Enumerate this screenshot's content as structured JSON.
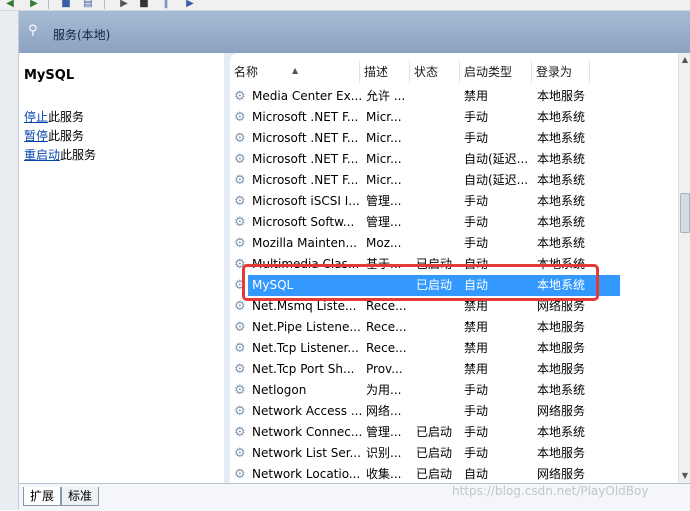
{
  "header": {
    "title": "服务(本地)"
  },
  "leftpane": {
    "service_name": "MySQL",
    "actions": [
      {
        "link": "停止",
        "text": "此服务"
      },
      {
        "link": "暂停",
        "text": "此服务"
      },
      {
        "link": "重启动",
        "text": "此服务"
      }
    ]
  },
  "columns": {
    "name": "名称",
    "desc": "描述",
    "status": "状态",
    "type": "启动类型",
    "logon": "登录为"
  },
  "rows": [
    {
      "name": "Media Center Ex...",
      "desc": "允许 ...",
      "status": "",
      "type": "禁用",
      "logon": "本地服务"
    },
    {
      "name": "Microsoft .NET F...",
      "desc": "Micr...",
      "status": "",
      "type": "手动",
      "logon": "本地系统"
    },
    {
      "name": "Microsoft .NET F...",
      "desc": "Micr...",
      "status": "",
      "type": "手动",
      "logon": "本地系统"
    },
    {
      "name": "Microsoft .NET F...",
      "desc": "Micr...",
      "status": "",
      "type": "自动(延迟...",
      "logon": "本地系统"
    },
    {
      "name": "Microsoft .NET F...",
      "desc": "Micr...",
      "status": "",
      "type": "自动(延迟...",
      "logon": "本地系统"
    },
    {
      "name": "Microsoft iSCSI I...",
      "desc": "管理...",
      "status": "",
      "type": "手动",
      "logon": "本地系统"
    },
    {
      "name": "Microsoft Softw...",
      "desc": "管理...",
      "status": "",
      "type": "手动",
      "logon": "本地系统"
    },
    {
      "name": "Mozilla Mainten...",
      "desc": "Moz...",
      "status": "",
      "type": "手动",
      "logon": "本地系统"
    },
    {
      "name": "Multimedia Clas...",
      "desc": "基于...",
      "status": "已启动",
      "type": "自动",
      "logon": "本地系统"
    },
    {
      "name": "MySQL",
      "desc": "",
      "status": "已启动",
      "type": "自动",
      "logon": "本地系统"
    },
    {
      "name": "Net.Msmq Liste...",
      "desc": "Rece...",
      "status": "",
      "type": "禁用",
      "logon": "网络服务"
    },
    {
      "name": "Net.Pipe Listene...",
      "desc": "Rece...",
      "status": "",
      "type": "禁用",
      "logon": "本地服务"
    },
    {
      "name": "Net.Tcp Listener...",
      "desc": "Rece...",
      "status": "",
      "type": "禁用",
      "logon": "本地服务"
    },
    {
      "name": "Net.Tcp Port Sh...",
      "desc": "Prov...",
      "status": "",
      "type": "禁用",
      "logon": "本地服务"
    },
    {
      "name": "Netlogon",
      "desc": "为用...",
      "status": "",
      "type": "手动",
      "logon": "本地系统"
    },
    {
      "name": "Network Access ...",
      "desc": "网络...",
      "status": "",
      "type": "手动",
      "logon": "网络服务"
    },
    {
      "name": "Network Connec...",
      "desc": "管理...",
      "status": "已启动",
      "type": "手动",
      "logon": "本地系统"
    },
    {
      "name": "Network List Ser...",
      "desc": "识别...",
      "status": "已启动",
      "type": "手动",
      "logon": "本地服务"
    },
    {
      "name": "Network Locatio...",
      "desc": "收集...",
      "status": "已启动",
      "type": "自动",
      "logon": "网络服务"
    }
  ],
  "tabs": [
    "扩展",
    "标准"
  ],
  "watermark": "https://blog.csdn.net/PlayOldBoy"
}
